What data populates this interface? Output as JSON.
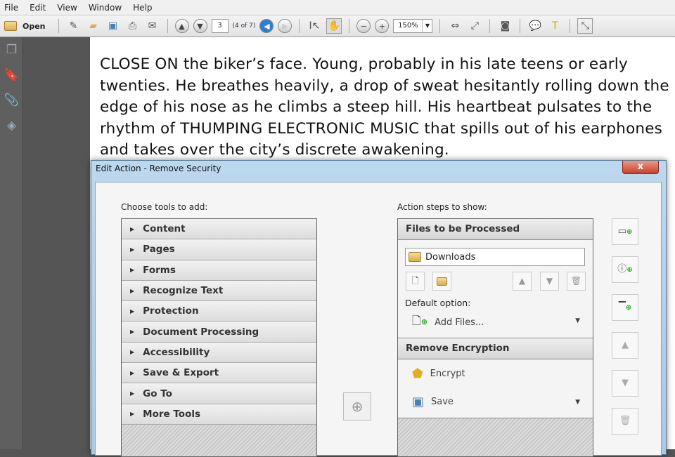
{
  "menu": [
    "File",
    "Edit",
    "View",
    "Window",
    "Help"
  ],
  "toolbar": {
    "open_label": "Open",
    "page_number": "3",
    "page_of": "(4 of 7)",
    "zoom": "150%"
  },
  "document": {
    "text": "CLOSE ON the biker’s face. Young, probably in his late teens or early twenties.  He breathes heavily, a drop of sweat hesitantly rolling down the edge of his nose as he climbs a steep hill. His heartbeat pulsates to the rhythm of THUMPING ELECTRONIC MUSIC that spills out of his earphones and takes over the city’s discrete awakening."
  },
  "dialog": {
    "title": "Edit Action - Remove Security",
    "close": "x",
    "tools_label": "Choose tools to add:",
    "tools": [
      "Content",
      "Pages",
      "Forms",
      "Recognize Text",
      "Protection",
      "Document Processing",
      "Accessibility",
      "Save & Export",
      "Go To",
      "More Tools"
    ],
    "steps_label": "Action steps to show:",
    "files_header": "Files to be Processed",
    "folder": "Downloads",
    "default_option_label": "Default option:",
    "default_option": "Add Files...",
    "encryption_header": "Remove Encryption",
    "steps": [
      "Encrypt",
      "Save"
    ]
  }
}
